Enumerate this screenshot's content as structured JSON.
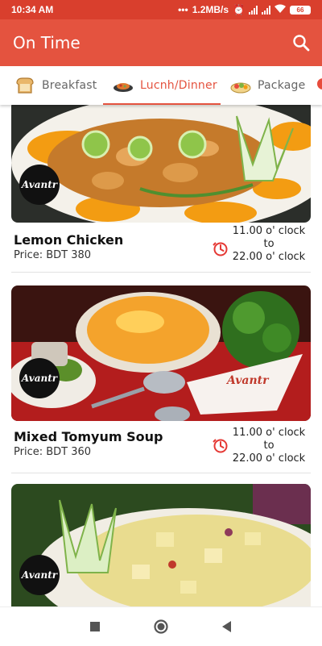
{
  "status_bar": {
    "time": "10:34 AM",
    "net_speed": "1.2MB/s",
    "battery": "66"
  },
  "app_bar": {
    "title": "On Time",
    "search_icon": "search-icon"
  },
  "tabs": [
    {
      "label": "Breakfast",
      "icon": "toast-icon",
      "active": false
    },
    {
      "label": "Lucnh/Dinner",
      "icon": "dish-icon",
      "active": true
    },
    {
      "label": "Package",
      "icon": "platter-icon",
      "active": false
    }
  ],
  "menu_items": [
    {
      "name": "Lemon Chicken",
      "price": "Price: BDT 380",
      "open_time": "11.00 o' clock",
      "to": "to",
      "close_time": "22.00 o' clock",
      "logo_text": "Avantr"
    },
    {
      "name": "Mixed Tomyum Soup",
      "price": "Price: BDT 360",
      "open_time": "11.00 o' clock",
      "to": "to",
      "close_time": "22.00 o' clock",
      "logo_text": "Avantr",
      "napkin_text": "Avantr"
    },
    {
      "name": "",
      "price": "",
      "logo_text": "Avantr"
    }
  ],
  "colors": {
    "primary": "#e4533f",
    "status_bar": "#d93f2d",
    "clock_icon": "#e53935"
  }
}
